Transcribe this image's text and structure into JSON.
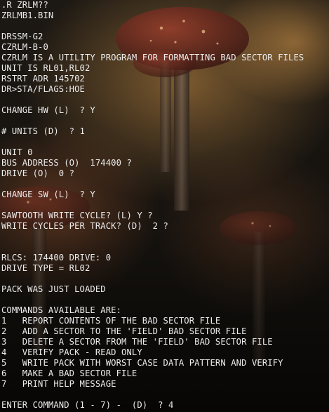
{
  "terminal": {
    "lines": [
      ".R ZRLM??",
      "ZRLMB1.BIN",
      "",
      "DRSSM-G2",
      "CZRLM-B-0",
      "CZRLM IS A UTILITY PROGRAM FOR FORMATTING BAD SECTOR FILES",
      "UNIT IS RL01,RL02",
      "RSTRT ADR 145702",
      "DR>STA/FLAGS:HOE",
      "",
      "CHANGE HW (L)  ? Y",
      "",
      "# UNITS (D)  ? 1",
      "",
      "UNIT 0",
      "BUS ADDRESS (O)  174400 ?",
      "DRIVE (O)  0 ?",
      "",
      "CHANGE SW (L)  ? Y",
      "",
      "SAWTOOTH WRITE CYCLE? (L) Y ?",
      "WRITE CYCLES PER TRACK? (D)  2 ?",
      "",
      "",
      "RLCS: 174400 DRIVE: 0",
      "DRIVE TYPE = RL02",
      "",
      "PACK WAS JUST LOADED",
      "",
      "COMMANDS AVAILABLE ARE:",
      "1   REPORT CONTENTS OF THE BAD SECTOR FILE",
      "2   ADD A SECTOR TO THE 'FIELD' BAD SECTOR FILE",
      "3   DELETE A SECTOR FROM THE 'FIELD' BAD SECTOR FILE",
      "4   VERIFY PACK - READ ONLY",
      "5   WRITE PACK WITH WORST CASE DATA PATTERN AND VERIFY",
      "6   MAKE A BAD SECTOR FILE",
      "7   PRINT HELP MESSAGE",
      "",
      "ENTER COMMAND (1 - 7) -  (D)  ? 4"
    ]
  }
}
